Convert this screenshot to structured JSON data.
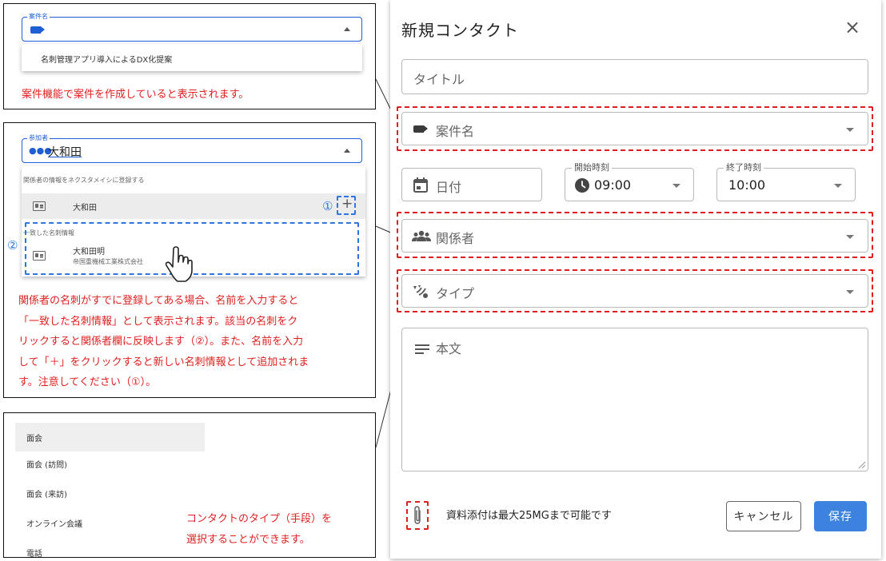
{
  "case_panel": {
    "legend": "案件名",
    "option": "名刺管理アプリ導入によるDX化提案",
    "note": "案件機能で案件を作成していると表示されます。"
  },
  "participant_panel": {
    "legend": "参加者",
    "value": "大和田",
    "header": "関係者の情報をネクスタメイシに登録する",
    "typed_name": "大和田",
    "marker_1": "①",
    "plus": "+",
    "marker_2": "②",
    "match_header": "一致した名刺情報",
    "match_name": "大和田明",
    "match_company": "帝国重機械工業株式会社",
    "note_lines": [
      "関係者の名刺がすでに登録してある場合、名前を入力すると",
      "「一致した名刺情報」として表示されます。該当の名刺をク",
      "リックすると関係者欄に反映します（②）。また、名前を入力",
      "して「＋」をクリックすると新しい名刺情報として追加されま",
      "す。注意してください（①）。"
    ]
  },
  "type_panel": {
    "options": [
      "面会",
      "面会 (訪問)",
      "面会 (来訪)",
      "オンライン会議",
      "電話"
    ],
    "note_lines": [
      "コンタクトのタイプ（手段）を",
      "選択することができます。"
    ]
  },
  "modal": {
    "title": "新規コンタクト",
    "close": "×",
    "title_placeholder": "タイトル",
    "case_placeholder": "案件名",
    "date_placeholder": "日付",
    "start_legend": "開始時刻",
    "start_value": "09:00",
    "end_legend": "終了時刻",
    "end_value": "10:00",
    "related_placeholder": "関係者",
    "type_placeholder": "タイプ",
    "body_placeholder": "本文",
    "attach_note": "資料添付は最大25MGまで可能です",
    "cancel_label": "キャンセル",
    "save_label": "保存",
    "colors": {
      "accent": "#3c82de",
      "annotation": "#e02020",
      "focus": "#1e5fd6"
    }
  }
}
